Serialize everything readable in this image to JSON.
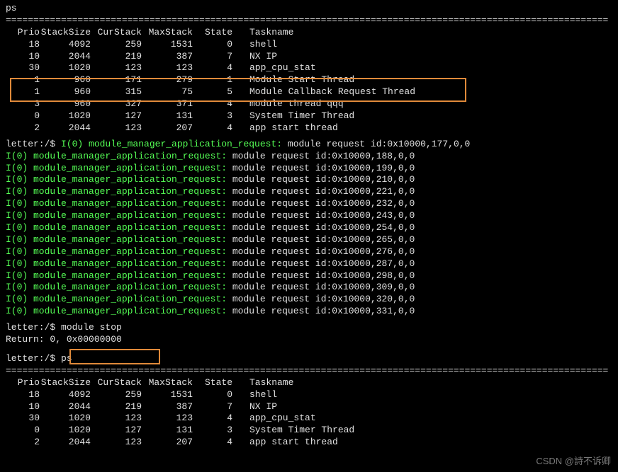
{
  "prompt_prefix": "letter:/$ ",
  "cmd_ps": "ps",
  "cmd_module_stop": "module stop",
  "return_line": "Return: 0, 0x00000000",
  "divider_line": "=============================================================================================================",
  "ps_headers": {
    "prio": "Prio",
    "stacksize": "StackSize",
    "curstack": "CurStack",
    "maxstack": "MaxStack",
    "state": "State",
    "taskname": "Taskname"
  },
  "ps_table1": [
    {
      "prio": "18",
      "ss": "4092",
      "cs": "259",
      "ms": "1531",
      "st": "0",
      "tn": "shell"
    },
    {
      "prio": "10",
      "ss": "2044",
      "cs": "219",
      "ms": "387",
      "st": "7",
      "tn": "NX IP"
    },
    {
      "prio": "30",
      "ss": "1020",
      "cs": "123",
      "ms": "123",
      "st": "4",
      "tn": "app_cpu_stat"
    },
    {
      "prio": "1",
      "ss": "960",
      "cs": "171",
      "ms": "279",
      "st": "1",
      "tn": "Module Start Thread"
    },
    {
      "prio": "1",
      "ss": "960",
      "cs": "315",
      "ms": "75",
      "st": "5",
      "tn": "Module Callback Request Thread"
    },
    {
      "prio": "3",
      "ss": "960",
      "cs": "327",
      "ms": "371",
      "st": "4",
      "tn": "module thread qqq"
    },
    {
      "prio": "0",
      "ss": "1020",
      "cs": "127",
      "ms": "131",
      "st": "3",
      "tn": "System Timer Thread"
    },
    {
      "prio": "2",
      "ss": "2044",
      "cs": "123",
      "ms": "207",
      "st": "4",
      "tn": "app start thread"
    }
  ],
  "ps_table2": [
    {
      "prio": "18",
      "ss": "4092",
      "cs": "259",
      "ms": "1531",
      "st": "0",
      "tn": "shell"
    },
    {
      "prio": "10",
      "ss": "2044",
      "cs": "219",
      "ms": "387",
      "st": "7",
      "tn": "NX IP"
    },
    {
      "prio": "30",
      "ss": "1020",
      "cs": "123",
      "ms": "123",
      "st": "4",
      "tn": "app_cpu_stat"
    },
    {
      "prio": "0",
      "ss": "1020",
      "cs": "127",
      "ms": "131",
      "st": "3",
      "tn": "System Timer Thread"
    },
    {
      "prio": "2",
      "ss": "2044",
      "cs": "123",
      "ms": "207",
      "st": "4",
      "tn": "app start thread"
    }
  ],
  "log_tag": "I(0) module_manager_application_request:",
  "log_msg_prefix": "module request id:0x10000,",
  "log_msg_suffix": ",0,0",
  "log_first_id": "177",
  "log_ids": [
    "188",
    "199",
    "210",
    "221",
    "232",
    "243",
    "254",
    "265",
    "276",
    "287",
    "298",
    "309",
    "320",
    "331"
  ],
  "watermark": "CSDN @詩不诉卿"
}
